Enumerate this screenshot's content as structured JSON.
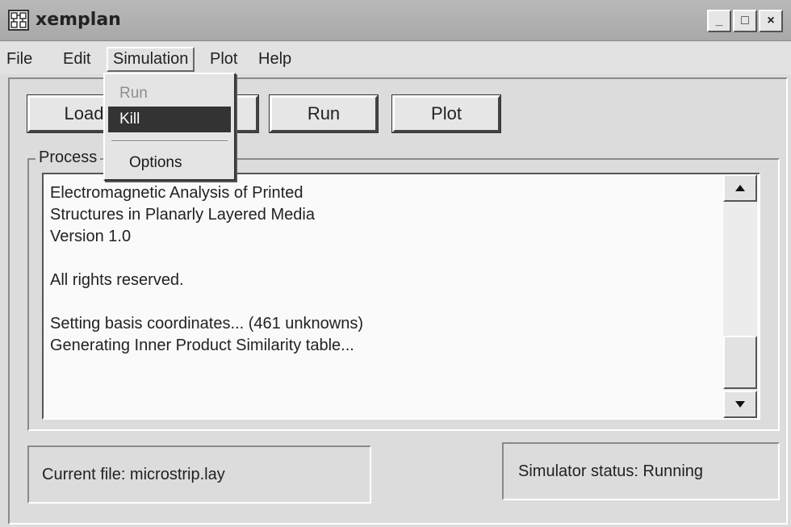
{
  "window": {
    "title": "xemplan",
    "minimize_label": "_",
    "maximize_label": "□",
    "close_label": "×"
  },
  "menubar": {
    "items": [
      {
        "label": "File"
      },
      {
        "label": "Edit"
      },
      {
        "label": "Simulation"
      },
      {
        "label": "Plot"
      },
      {
        "label": "Help"
      }
    ]
  },
  "simulation_menu": {
    "items": [
      {
        "label": "Run",
        "enabled": false
      },
      {
        "label": "Kill",
        "enabled": true,
        "highlighted": true
      },
      {
        "label": "Options",
        "enabled": true
      }
    ]
  },
  "toolbar": {
    "load_label": "Load",
    "run_label": "Run",
    "plot_label": "Plot"
  },
  "process": {
    "group_label": "Process",
    "lines": [
      "Electromagnetic Analysis of Printed",
      "Structures in Planarly Layered Media",
      "Version 1.0",
      "",
      "All rights reserved.",
      "",
      "Setting basis coordinates... (461 unknowns)",
      "Generating Inner Product Similarity table..."
    ]
  },
  "status": {
    "current_file": "Current file: microstrip.lay",
    "simulator_status": "Simulator status: Running"
  },
  "colors": {
    "menu_highlight": "#333333",
    "window_bg": "#dcdcdc"
  }
}
